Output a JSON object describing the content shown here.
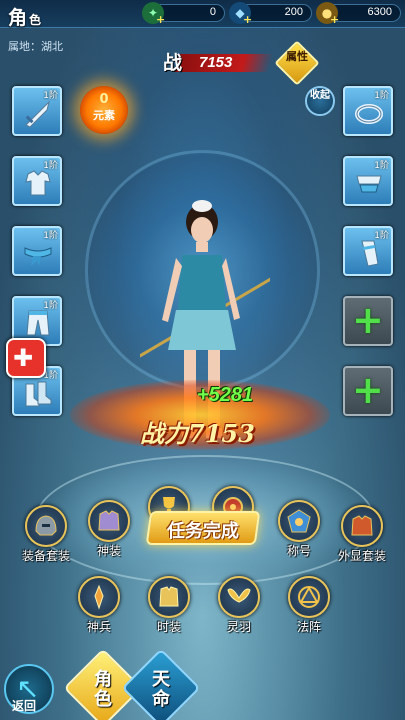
{
  "header": {
    "title_main": "角",
    "title_small": "色",
    "resources": [
      {
        "name": "jade",
        "value": "0",
        "icon": "jade-icon",
        "color": "#3fbf6a"
      },
      {
        "name": "diamond",
        "value": "200",
        "icon": "diamond-icon",
        "color": "#4fb6ff"
      },
      {
        "name": "gold",
        "value": "6300",
        "icon": "gold-coin-icon",
        "color": "#f3c23a"
      }
    ],
    "plus": "+"
  },
  "location": "属地：湖北",
  "power_top": {
    "label": "战",
    "value": "7153"
  },
  "attr_button": "属性",
  "collapse_button": "收起",
  "yuanxi": {
    "value": "0",
    "label": "元素"
  },
  "slots_left": [
    {
      "tier": "1阶",
      "icon": "sword-icon"
    },
    {
      "tier": "1阶",
      "icon": "armor-icon"
    },
    {
      "tier": "1阶",
      "icon": "belt-icon"
    },
    {
      "tier": "1阶",
      "icon": "pants-icon"
    },
    {
      "tier": "1阶",
      "icon": "boots-icon"
    }
  ],
  "slots_right": [
    {
      "tier": "1阶",
      "icon": "ring-icon"
    },
    {
      "tier": "1阶",
      "icon": "necklace-icon"
    },
    {
      "tier": "1阶",
      "icon": "bracer-icon"
    },
    {
      "tier": "",
      "icon": "add-icon"
    },
    {
      "tier": "",
      "icon": "add-icon"
    }
  ],
  "plus_power": "+5281",
  "power_big": "战力7153",
  "functions_row1": [
    {
      "label": "装备套装",
      "icon": "helmet-icon"
    },
    {
      "label": "神装",
      "icon": "divine-armor-icon"
    },
    {
      "label": "",
      "icon": "trophy-icon"
    },
    {
      "label": "",
      "icon": "orb-icon"
    },
    {
      "label": "称号",
      "icon": "title-badge-icon"
    },
    {
      "label": "外显套装",
      "icon": "costume-icon"
    }
  ],
  "task_banner": "任务完成",
  "functions_row2": [
    {
      "label": "神兵",
      "icon": "divine-weapon-icon"
    },
    {
      "label": "时装",
      "icon": "fashion-icon"
    },
    {
      "label": "灵羽",
      "icon": "wings-icon"
    },
    {
      "label": "法阵",
      "icon": "magic-circle-icon"
    }
  ],
  "bottom": {
    "back": "返回",
    "tab_role_1": "角",
    "tab_role_2": "色",
    "tab_fate_1": "天",
    "tab_fate_2": "命"
  }
}
